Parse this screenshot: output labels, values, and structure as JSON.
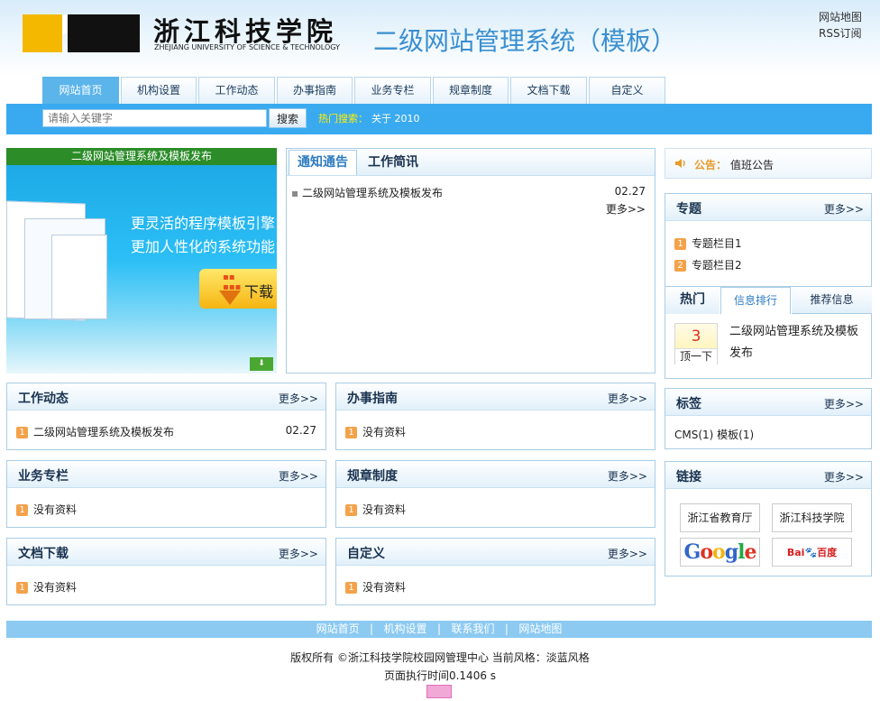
{
  "header": {
    "logo_text": "浙江科技学院",
    "logo_subtitle": "ZHEJIANG UNIVERSITY OF SCIENCE & TECHNOLOGY",
    "site_title": "二级网站管理系统（模板）",
    "top_links": [
      "网站地图",
      "RSS订阅"
    ]
  },
  "nav": {
    "tabs": [
      "网站首页",
      "机构设置",
      "工作动态",
      "办事指南",
      "业务专栏",
      "规章制度",
      "文档下载",
      "自定义"
    ],
    "active": 0
  },
  "search": {
    "placeholder": "请输入关键字",
    "button": "搜索",
    "hot_label": "热门搜索：",
    "hot_items": "关于  2010"
  },
  "banner": {
    "caption": "二级网站管理系统及模板发布",
    "line1": "更灵活的程序模板引擎",
    "line2": "更加人性化的系统功能",
    "download_label": "下载"
  },
  "notice": {
    "tab_active": "通知通告",
    "tab_other": "工作简讯",
    "items": [
      {
        "title": "二级网站管理系统及模板发布",
        "date": "02.27"
      }
    ],
    "more": "更多>>"
  },
  "announcement": {
    "label": "公告：",
    "text": "值班公告"
  },
  "topic": {
    "title": "专题",
    "more": "更多>>",
    "items": [
      {
        "num": "1",
        "label": "专题栏目1"
      },
      {
        "num": "2",
        "label": "专题栏目2"
      }
    ]
  },
  "hot": {
    "tabs": [
      "热门",
      "信息排行",
      "推荐信息"
    ],
    "vote_count": "3",
    "vote_button": "顶一下",
    "item": "二级网站管理系统及模板发布"
  },
  "tags": {
    "title": "标签",
    "more": "更多>>",
    "list": "CMS(1) 模板(1)"
  },
  "links": {
    "title": "链接",
    "more": "更多>>",
    "items": [
      "浙江省教育厅",
      "浙江科技学院",
      "Google",
      "Baidu百度"
    ],
    "google_sub": "谷歌"
  },
  "sections": [
    {
      "title": "工作动态",
      "more": "更多>>",
      "num": "1",
      "item": "二级网站管理系统及模板发布",
      "date": "02.27"
    },
    {
      "title": "办事指南",
      "more": "更多>>",
      "num": "1",
      "item": "没有资料",
      "date": ""
    },
    {
      "title": "业务专栏",
      "more": "更多>>",
      "num": "1",
      "item": "没有资料",
      "date": ""
    },
    {
      "title": "规章制度",
      "more": "更多>>",
      "num": "1",
      "item": "没有资料",
      "date": ""
    },
    {
      "title": "文档下载",
      "more": "更多>>",
      "num": "1",
      "item": "没有资料",
      "date": ""
    },
    {
      "title": "自定义",
      "more": "更多>>",
      "num": "1",
      "item": "没有资料",
      "date": ""
    }
  ],
  "footer": {
    "links": "网站首页   |   机构设置   |   联系我们   |   网站地图",
    "copyright": "版权所有 ©浙江科技学院校园网管理中心   当前风格：淡蓝风格",
    "runtime": "页面执行时间0.1406 s"
  }
}
